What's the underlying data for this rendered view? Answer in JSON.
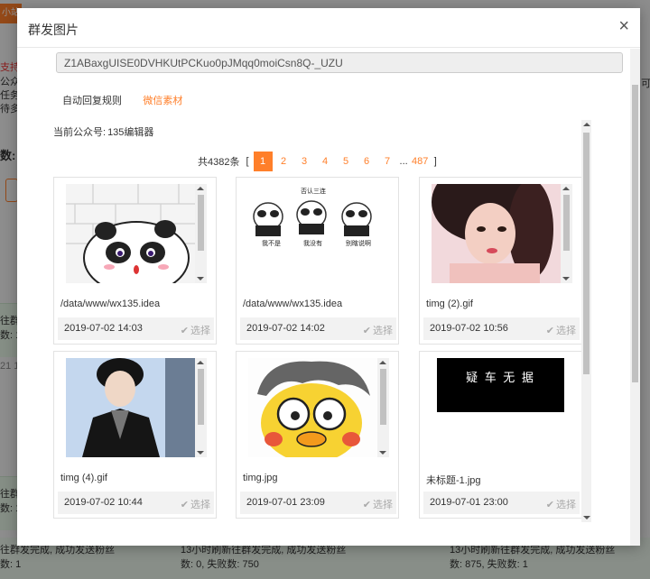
{
  "background": {
    "button_text": "小站",
    "line1": "支持",
    "line2": "公众",
    "line3": "任务",
    "line4": "待多",
    "label": "数:",
    "row1": "往群",
    "row1b": "数: 1",
    "row2": "21 1",
    "row3": "往群",
    "row3b": "数: 1",
    "right_text": "可,",
    "bottom": {
      "left_a": "往群发完成, 成功发送粉丝",
      "left_b": "数: 1",
      "mid_a": "13小时刷新往群发完成, 成功发送粉丝",
      "mid_b": "数: 0, 失败数: 750",
      "right_a": "13小时刷新往群发完成, 成功发送粉丝",
      "right_b": "数: 875, 失败数: 1"
    }
  },
  "modal": {
    "title": "群发图片",
    "close": "×",
    "token": "Z1ABaxgUISE0DVHKUtPCKuo0pJMqq0moiCsn8Q-_UZU",
    "tabs": [
      {
        "label": "自动回复规则",
        "active": false
      },
      {
        "label": "微信素材",
        "active": true
      }
    ],
    "current_account_label": "当前公众号:",
    "current_account_value": "135编辑器",
    "pager": {
      "total": "共4382条",
      "open": "[",
      "close": "]",
      "pages": [
        "1",
        "2",
        "3",
        "4",
        "5",
        "6",
        "7"
      ],
      "ellipsis": "...",
      "last": "487",
      "current": "1"
    },
    "select_label": "选择",
    "cards": [
      {
        "name": "/data/www/wx135.idea",
        "date": "2019-07-02 14:03",
        "thumb": "panda-wall"
      },
      {
        "name": "/data/www/wx135.idea",
        "date": "2019-07-02 14:02",
        "thumb": "panda-memes",
        "captions": [
          "否认三连",
          "我不是",
          "我没有",
          "别瞎说啊"
        ]
      },
      {
        "name": "timg (2).gif",
        "date": "2019-07-02 10:56",
        "thumb": "portrait-girl"
      },
      {
        "name": "timg (4).gif",
        "date": "2019-07-02 10:44",
        "thumb": "portrait-boy"
      },
      {
        "name": "timg.jpg",
        "date": "2019-07-01 23:09",
        "thumb": "cartoon-face"
      },
      {
        "name": "未标题-1.jpg",
        "date": "2019-07-01 23:00",
        "thumb": "black-banner",
        "banner_text": "疑 车 无 据"
      }
    ]
  },
  "colors": {
    "accent": "#ff7f2a",
    "overlay": "rgba(0,0,0,0.42)"
  }
}
